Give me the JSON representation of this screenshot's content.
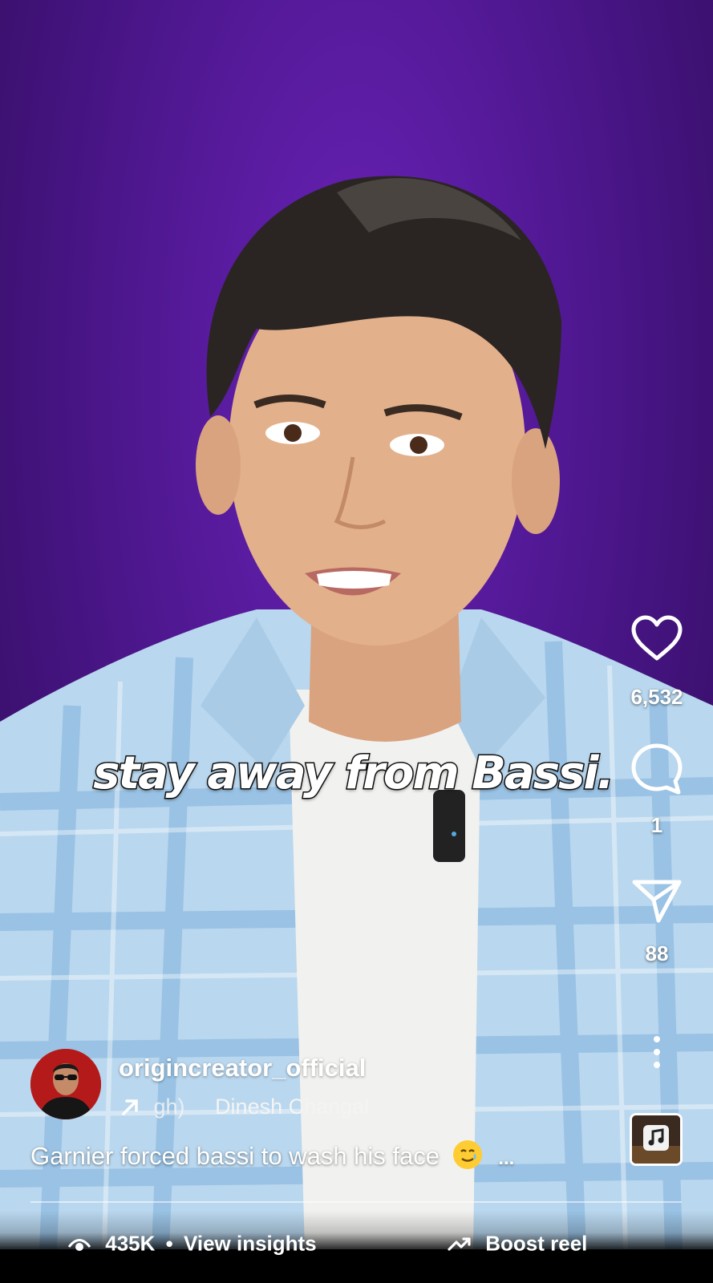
{
  "caption": "stay away from Bassi.",
  "actions": {
    "likes": "6,532",
    "comments": "1",
    "shares": "88"
  },
  "author": {
    "username": "origincreator_official",
    "audio_partial": "gh)",
    "audio_artist": "Dinesh Changal"
  },
  "description": {
    "text": "Garnier forced bassi to wash his face",
    "more": "..."
  },
  "stats": {
    "views": "435K",
    "separator": "•",
    "insights_label": "View insights",
    "boost_label": "Boost reel"
  },
  "icons": {
    "like": "heart-icon",
    "comment": "comment-bubble-icon",
    "share": "paper-plane-icon",
    "more": "more-vertical-icon",
    "audio": "music-note-icon",
    "views": "eye-icon",
    "boost": "trending-up-icon",
    "audio_link": "arrow-up-right-icon"
  },
  "colors": {
    "background_purple": "#4e178f",
    "text": "#ffffff"
  }
}
